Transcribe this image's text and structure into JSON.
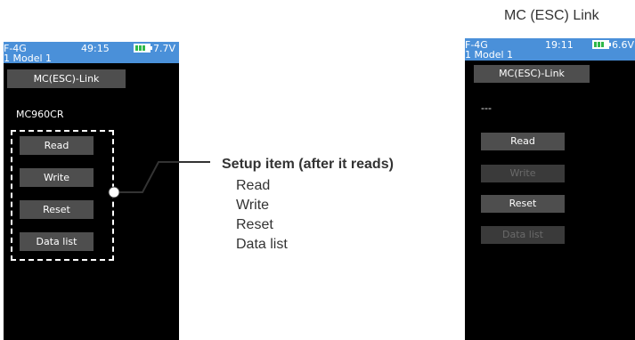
{
  "left_screen": {
    "header": {
      "line1": "F-4G",
      "line2": "1  Model 1",
      "time": "49:15",
      "voltage": "7.7V"
    },
    "title": "MC(ESC)-Link",
    "status": "MC960CR",
    "buttons": [
      {
        "label": "Read",
        "enabled": true
      },
      {
        "label": "Write",
        "enabled": true
      },
      {
        "label": "Reset",
        "enabled": true
      },
      {
        "label": "Data list",
        "enabled": true
      }
    ]
  },
  "callout": {
    "heading": "Setup item (after it reads)",
    "items": [
      "Read",
      "Write",
      "Reset",
      "Data list"
    ]
  },
  "right_panel_title": "MC (ESC) Link",
  "right_screen": {
    "header": {
      "line1": "F-4G",
      "line2": "1  Model 1",
      "time": "19:11",
      "voltage": "6.6V"
    },
    "title": "MC(ESC)-Link",
    "status": "---",
    "buttons": [
      {
        "label": "Read",
        "enabled": true
      },
      {
        "label": "Write",
        "enabled": false
      },
      {
        "label": "Reset",
        "enabled": true
      },
      {
        "label": "Data list",
        "enabled": false
      }
    ]
  },
  "colors": {
    "header_blue": "#4a90d9",
    "button_gray": "#4e4e4e",
    "battery_green": "#2fb84a"
  }
}
